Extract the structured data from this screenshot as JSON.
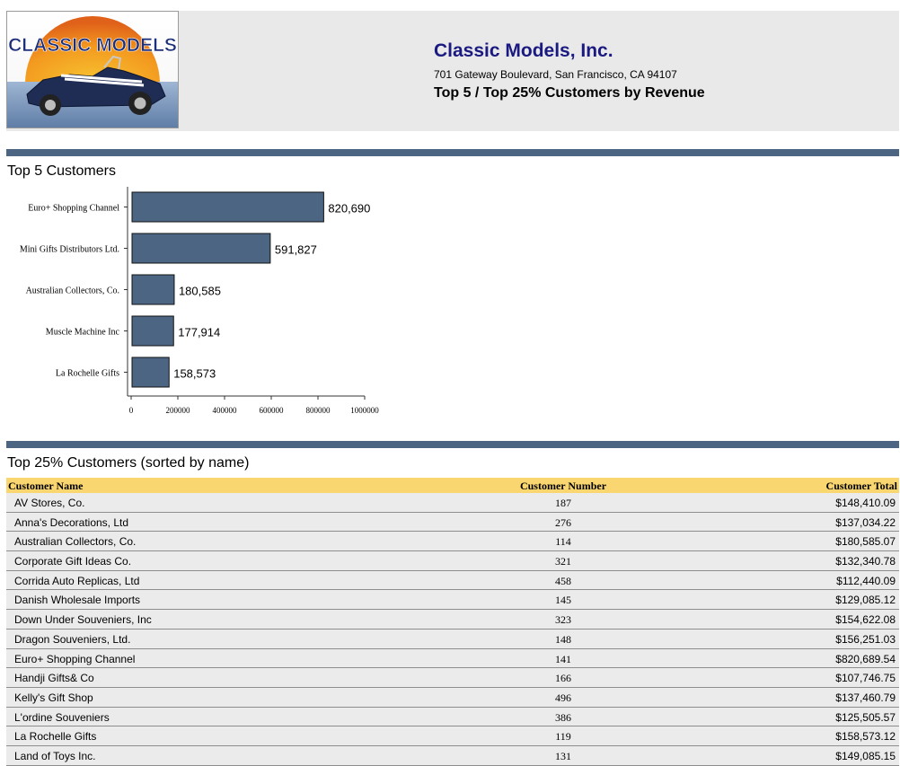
{
  "header": {
    "logo_text": "CLASSIC MODELS",
    "company_name": "Classic Models, Inc.",
    "address": "701 Gateway Boulevard, San Francisco, CA 94107",
    "report_title": "Top 5 / Top 25% Customers by Revenue"
  },
  "sections": {
    "top5_title": "Top 5 Customers",
    "top25_title": "Top 25% Customers (sorted by name)"
  },
  "colors": {
    "accent_bar": "#4c6582",
    "table_header": "#fad671",
    "company_name": "#1a1a80"
  },
  "chart_data": {
    "type": "bar",
    "orientation": "horizontal",
    "categories": [
      "Euro+ Shopping Channel",
      "Mini Gifts Distributors Ltd.",
      "Australian Collectors, Co.",
      "Muscle Machine Inc",
      "La Rochelle Gifts"
    ],
    "values": [
      820690,
      591827,
      180585,
      177914,
      158573
    ],
    "value_labels": [
      "820,690",
      "591,827",
      "180,585",
      "177,914",
      "158,573"
    ],
    "xlim": [
      0,
      1000000
    ],
    "xticks": [
      0,
      200000,
      400000,
      600000,
      800000,
      1000000
    ],
    "xtick_labels": [
      "0",
      "200000",
      "400000",
      "600000",
      "800000",
      "1000000"
    ],
    "bar_color": "#4c6582",
    "grid": false,
    "legend": false
  },
  "table": {
    "columns": [
      "Customer Name",
      "Customer Number",
      "Customer Total"
    ],
    "rows": [
      [
        "AV Stores, Co.",
        "187",
        "$148,410.09"
      ],
      [
        "Anna's Decorations, Ltd",
        "276",
        "$137,034.22"
      ],
      [
        "Australian Collectors, Co.",
        "114",
        "$180,585.07"
      ],
      [
        "Corporate Gift Ideas Co.",
        "321",
        "$132,340.78"
      ],
      [
        "Corrida Auto Replicas, Ltd",
        "458",
        "$112,440.09"
      ],
      [
        "Danish Wholesale Imports",
        "145",
        "$129,085.12"
      ],
      [
        "Down Under Souveniers, Inc",
        "323",
        "$154,622.08"
      ],
      [
        "Dragon Souveniers, Ltd.",
        "148",
        "$156,251.03"
      ],
      [
        "Euro+ Shopping Channel",
        "141",
        "$820,689.54"
      ],
      [
        "Handji Gifts& Co",
        "166",
        "$107,746.75"
      ],
      [
        "Kelly's Gift Shop",
        "496",
        "$137,460.79"
      ],
      [
        "L'ordine Souveniers",
        "386",
        "$125,505.57"
      ],
      [
        "La Rochelle Gifts",
        "119",
        "$158,573.12"
      ],
      [
        "Land of Toys Inc.",
        "131",
        "$149,085.15"
      ]
    ]
  }
}
